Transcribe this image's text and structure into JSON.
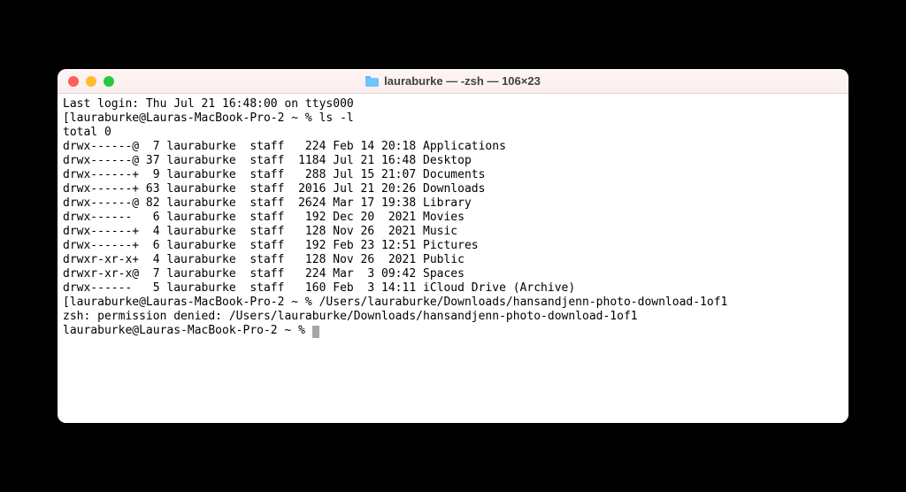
{
  "window": {
    "title": "lauraburke — -zsh — 106×23"
  },
  "terminal": {
    "last_login": "Last login: Thu Jul 21 16:48:00 on ttys000",
    "prompt1_open": "[",
    "prompt1_text": "lauraburke@Lauras-MacBook-Pro-2 ~ % ",
    "command1": "ls -l",
    "total": "total 0",
    "listing": [
      "drwx------@  7 lauraburke  staff   224 Feb 14 20:18 Applications",
      "drwx------@ 37 lauraburke  staff  1184 Jul 21 16:48 Desktop",
      "drwx------+  9 lauraburke  staff   288 Jul 15 21:07 Documents",
      "drwx------+ 63 lauraburke  staff  2016 Jul 21 20:26 Downloads",
      "drwx------@ 82 lauraburke  staff  2624 Mar 17 19:38 Library",
      "drwx------   6 lauraburke  staff   192 Dec 20  2021 Movies",
      "drwx------+  4 lauraburke  staff   128 Nov 26  2021 Music",
      "drwx------+  6 lauraburke  staff   192 Feb 23 12:51 Pictures",
      "drwxr-xr-x+  4 lauraburke  staff   128 Nov 26  2021 Public",
      "drwxr-xr-x@  7 lauraburke  staff   224 Mar  3 09:42 Spaces",
      "drwx------   5 lauraburke  staff   160 Feb  3 14:11 iCloud Drive (Archive)"
    ],
    "prompt2_open": "[",
    "prompt2_text": "lauraburke@Lauras-MacBook-Pro-2 ~ % ",
    "command2": "/Users/lauraburke/Downloads/hansandjenn-photo-download-1of1",
    "error": "zsh: permission denied: /Users/lauraburke/Downloads/hansandjenn-photo-download-1of1",
    "prompt3_text": "lauraburke@Lauras-MacBook-Pro-2 ~ % "
  }
}
